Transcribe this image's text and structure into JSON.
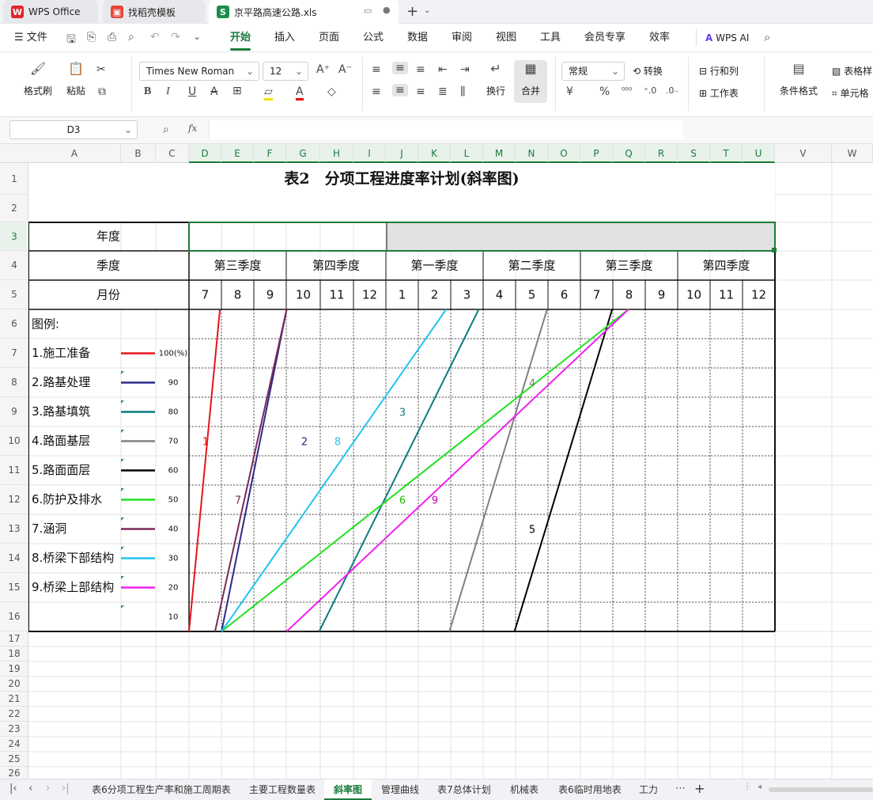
{
  "tabs": [
    {
      "label": "WPS Office",
      "icon": "wps-logo-icon"
    },
    {
      "label": "找稻壳模板",
      "icon": "docer-icon"
    },
    {
      "label": "京平路高速公路.xls",
      "icon": "spreadsheet-icon"
    }
  ],
  "menu": {
    "file": "文件",
    "items": [
      "开始",
      "插入",
      "页面",
      "公式",
      "数据",
      "审阅",
      "视图",
      "工具",
      "会员专享",
      "效率"
    ],
    "wps_ai": "WPS AI"
  },
  "ribbon": {
    "format_painter": "格式刷",
    "paste": "粘贴",
    "font_name": "Times New Roman",
    "font_size": "12",
    "wrap": "换行",
    "merge": "合并",
    "number_format": "常规",
    "convert": "转换",
    "row_col": "行和列",
    "worksheet": "工作表",
    "cond_format": "条件格式",
    "table_style": "表格样",
    "cell": "单元格"
  },
  "formula": {
    "cell_ref": "D3",
    "fx": "fx",
    "value": ""
  },
  "columns": [
    "A",
    "B",
    "C",
    "D",
    "E",
    "F",
    "G",
    "H",
    "I",
    "J",
    "K",
    "L",
    "M",
    "N",
    "O",
    "P",
    "Q",
    "R",
    "S",
    "T",
    "U",
    "V",
    "W"
  ],
  "rows": [
    "1",
    "2",
    "3",
    "4",
    "5",
    "6",
    "7",
    "8",
    "9",
    "10",
    "11",
    "12",
    "13",
    "14",
    "15",
    "16",
    "17",
    "18",
    "19",
    "20",
    "21",
    "22",
    "23",
    "24",
    "25",
    "26"
  ],
  "sheet": {
    "title": "表2　分项工程进度率计划(斜率图)",
    "year_label": "年度",
    "quarter_label": "季度",
    "month_label": "月份",
    "quarters": [
      "第三季度",
      "第四季度",
      "第一季度",
      "第二季度",
      "第三季度",
      "第四季度"
    ],
    "months": [
      "7",
      "8",
      "9",
      "10",
      "11",
      "12",
      "1",
      "2",
      "3",
      "4",
      "5",
      "6",
      "7",
      "8",
      "9",
      "10",
      "11",
      "12"
    ],
    "legend_title": "图例:",
    "legend": [
      {
        "label": "1.施工准备",
        "color": "#e8141b"
      },
      {
        "label": "2.路基处理",
        "color": "#2d2a88"
      },
      {
        "label": "3.路基填筑",
        "color": "#0e7c80"
      },
      {
        "label": "4.路面基层",
        "color": "#808080"
      },
      {
        "label": "5.路面面层",
        "color": "#000000"
      },
      {
        "label": "6.防护及排水",
        "color": "#22e022"
      },
      {
        "label": "7.涵洞",
        "color": "#7a2a5a"
      },
      {
        "label": "8.桥梁下部结构",
        "color": "#22c4ee"
      },
      {
        "label": "9.桥梁上部结构",
        "color": "#f020f0"
      }
    ],
    "percent_labels": [
      "100(%)",
      "90",
      "80",
      "70",
      "60",
      "50",
      "40",
      "30",
      "20",
      "10"
    ],
    "line_labels": [
      "1",
      "2",
      "3",
      "4",
      "5",
      "6",
      "7",
      "8",
      "9"
    ]
  },
  "chart_data": {
    "type": "line",
    "x_axis": "months (7 = July of year 1 … 24 = December of year 2)",
    "ylim": [
      0,
      100
    ],
    "series": [
      {
        "name": "1.施工准备",
        "color": "#e8141b",
        "x": [
          7.0,
          7.95
        ],
        "y": [
          0,
          100
        ]
      },
      {
        "name": "2.路基处理",
        "color": "#2d2a88",
        "x": [
          8.0,
          10.0
        ],
        "y": [
          0,
          100
        ]
      },
      {
        "name": "3.路基填筑",
        "color": "#0e7c80",
        "x": [
          11.0,
          15.9
        ],
        "y": [
          0,
          100
        ]
      },
      {
        "name": "4.路面基层",
        "color": "#808080",
        "x": [
          15.0,
          18.0
        ],
        "y": [
          0,
          100
        ]
      },
      {
        "name": "5.路面面层",
        "color": "#000000",
        "x": [
          17.0,
          20.0
        ],
        "y": [
          0,
          100
        ]
      },
      {
        "name": "6.防护及排水",
        "color": "#22e022",
        "x": [
          8.0,
          20.5
        ],
        "y": [
          0,
          100
        ]
      },
      {
        "name": "7.涵洞",
        "color": "#7a2a5a",
        "x": [
          7.8,
          10.0
        ],
        "y": [
          0,
          100
        ]
      },
      {
        "name": "8.桥梁下部结构",
        "color": "#22c4ee",
        "x": [
          8.0,
          14.9
        ],
        "y": [
          0,
          100
        ]
      },
      {
        "name": "9.桥梁上部结构",
        "color": "#f020f0",
        "x": [
          10.0,
          20.5
        ],
        "y": [
          0,
          100
        ]
      }
    ]
  },
  "sheet_tabs": [
    "表6分项工程生产率和施工周期表",
    "主要工程数量表",
    "斜率图",
    "管理曲线",
    "表7总体计划",
    "机械表",
    "表6临时用地表",
    "工力"
  ]
}
